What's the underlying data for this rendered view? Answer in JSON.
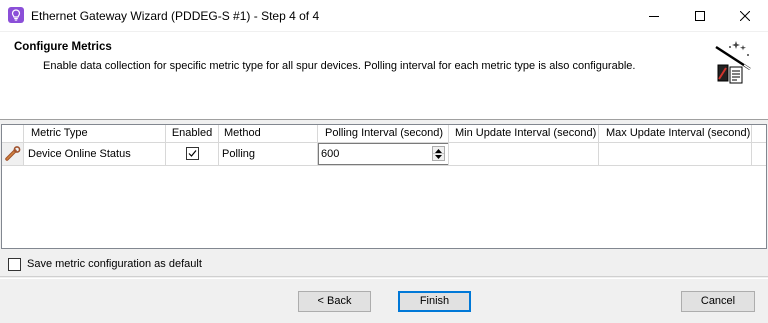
{
  "window": {
    "title": "Ethernet Gateway Wizard (PDDEG-S #1) - Step 4 of 4",
    "icon": "lightbulb-icon",
    "controls": [
      "minimize-icon",
      "maximize-icon",
      "close-icon"
    ]
  },
  "header": {
    "title": "Configure Metrics",
    "description": "Enable data collection for specific metric type for all spur devices. Polling interval for each metric type is also configurable.",
    "icon": "wizard-wand-icon"
  },
  "grid": {
    "columns": [
      "",
      "Metric Type",
      "Enabled",
      "Method",
      "Polling Interval (second)",
      "Min Update Interval (second)",
      "Max Update Interval (second)",
      ""
    ],
    "rows": [
      {
        "row_icon": "wrench-icon",
        "metric_type": "Device Online Status",
        "enabled": true,
        "method": "Polling",
        "polling_interval": "600",
        "min_update_interval": "",
        "max_update_interval": ""
      }
    ]
  },
  "options": {
    "save_default_label": "Save metric configuration as default",
    "save_default_checked": false
  },
  "buttons": {
    "back": "< Back",
    "finish": "Finish",
    "cancel": "Cancel"
  },
  "colors": {
    "accent": "#0078d7",
    "title_icon": "#8b4fd8"
  }
}
